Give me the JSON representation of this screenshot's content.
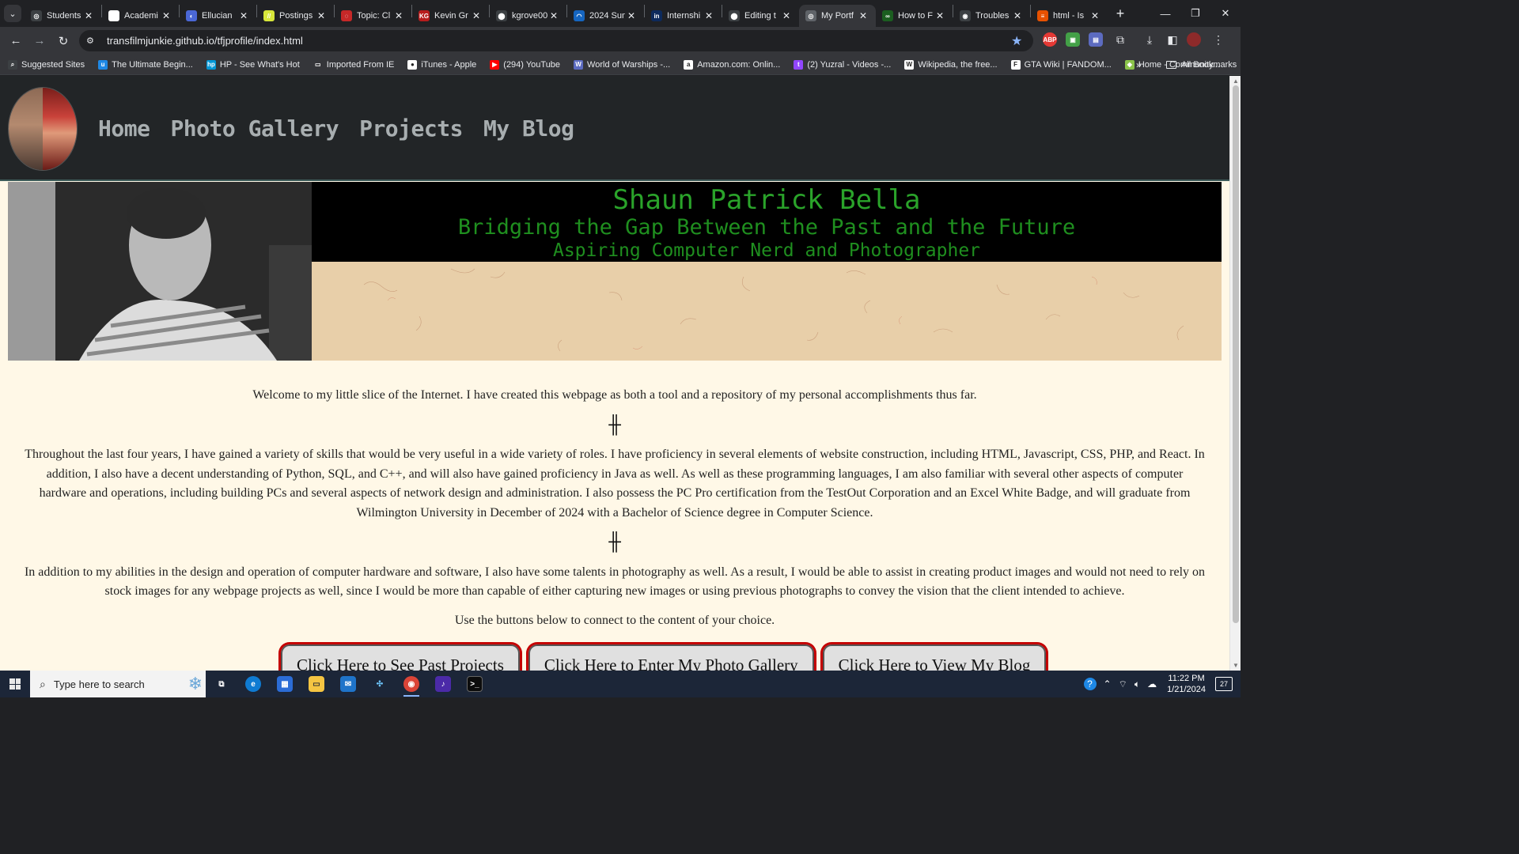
{
  "browser": {
    "tabs": [
      {
        "title": "Students",
        "favicon_color": "#3c4043",
        "favicon_text": "◎",
        "active": false
      },
      {
        "title": "Academi",
        "favicon_color": "#ffffff",
        "favicon_text": "A",
        "active": false
      },
      {
        "title": "Ellucian",
        "favicon_color": "#4a67d6",
        "favicon_text": "◐",
        "active": false
      },
      {
        "title": "Postings",
        "favicon_color": "#d7e63a",
        "favicon_text": "//",
        "active": false
      },
      {
        "title": "Topic: Cl",
        "favicon_color": "#c62828",
        "favicon_text": "◌",
        "active": false
      },
      {
        "title": "Kevin Gr",
        "favicon_color": "#b71c1c",
        "favicon_text": "KG",
        "active": false
      },
      {
        "title": "kgrove00",
        "favicon_color": "#3c4043",
        "favicon_text": "⬤",
        "active": false
      },
      {
        "title": "2024 Sun",
        "favicon_color": "#1565c0",
        "favicon_text": "◠",
        "active": false
      },
      {
        "title": "Internshi",
        "favicon_color": "#0d2a5c",
        "favicon_text": "in",
        "active": false
      },
      {
        "title": "Editing t",
        "favicon_color": "#3c4043",
        "favicon_text": "⬤",
        "active": false
      },
      {
        "title": "My Portf",
        "favicon_color": "#5f6368",
        "favicon_text": "◎",
        "active": true
      },
      {
        "title": "How to F",
        "favicon_color": "#1b5e20",
        "favicon_text": "∞",
        "active": false
      },
      {
        "title": "Troubles",
        "favicon_color": "#3c4043",
        "favicon_text": "◉",
        "active": false
      },
      {
        "title": "html - Is",
        "favicon_color": "#e65100",
        "favicon_text": "≡",
        "active": false
      }
    ],
    "new_tab_label": "+",
    "url": "transfilmjunkie.github.io/tfjprofile/index.html",
    "bookmarks": [
      {
        "label": "Suggested Sites",
        "color": "#3c4043",
        "icon": "⌕"
      },
      {
        "label": "The Ultimate Begin...",
        "color": "#1e88e5",
        "icon": "u"
      },
      {
        "label": "HP - See What's Hot",
        "color": "#0096d6",
        "icon": "hp"
      },
      {
        "label": "Imported From IE",
        "color": "#35363a",
        "icon": "▭"
      },
      {
        "label": "iTunes - Apple",
        "color": "#ffffff",
        "icon": "●"
      },
      {
        "label": "(294) YouTube",
        "color": "#ff0000",
        "icon": "▶"
      },
      {
        "label": "World of Warships -...",
        "color": "#5c6bc0",
        "icon": "W"
      },
      {
        "label": "Amazon.com: Onlin...",
        "color": "#ffffff",
        "icon": "a"
      },
      {
        "label": "(2) Yuzral - Videos -...",
        "color": "#9146ff",
        "icon": "t"
      },
      {
        "label": "Wikipedia, the free...",
        "color": "#ffffff",
        "icon": "W"
      },
      {
        "label": "GTA Wiki | FANDOM...",
        "color": "#ffffff",
        "icon": "F"
      },
      {
        "label": "Home - Community...",
        "color": "#8bc34a",
        "icon": "◆"
      }
    ],
    "bookmarks_more": "»",
    "all_bookmarks": "All Bookmarks"
  },
  "site": {
    "nav": [
      "Home",
      "Photo Gallery",
      "Projects",
      "My Blog"
    ],
    "hero": {
      "name": "Shaun Patrick Bella",
      "tagline": "Bridging the Gap Between the Past and the Future",
      "subtitle": "Aspiring Computer Nerd and Photographer"
    },
    "paragraphs": [
      "Welcome to my little slice of the Internet. I have created this webpage as both a tool and a repository of my personal accomplishments thus far.",
      "Throughout the last four years, I have gained a variety of skills that would be very useful in a wide variety of roles. I have proficiency in several elements of website construction, including HTML, Javascript, CSS, PHP, and React. In addition, I also have a decent understanding of Python, SQL, and C++, and will also have gained proficiency in Java as well. As well as these programming languages, I am also familiar with several other aspects of computer hardware and operations, including building PCs and several aspects of network design and administration. I also possess the PC Pro certification from the TestOut Corporation and an Excel White Badge, and will graduate from Wilmington University in December of 2024 with a Bachelor of Science degree in Computer Science.",
      "In addition to my abilities in the design and operation of computer hardware and software, I also have some talents in photography as well. As a result, I would be able to assist in creating product images and would not need to rely on stock images for any webpage projects as well, since I would be more than capable of either capturing new images or using previous photographs to convey the vision that the client intended to achieve.",
      "Use the buttons below to connect to the content of your choice."
    ],
    "divider": "╫",
    "buttons": [
      "Click Here to See Past Projects",
      "Click Here to Enter My Photo Gallery",
      "Click Here to View My Blog"
    ]
  },
  "taskbar": {
    "search_placeholder": "Type here to search",
    "time": "11:22 PM",
    "date": "1/21/2024",
    "notifications": "27"
  }
}
